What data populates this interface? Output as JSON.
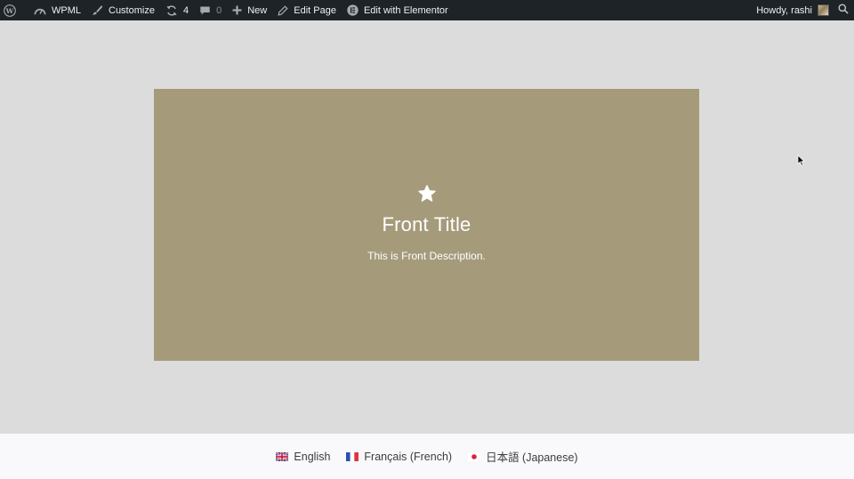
{
  "adminbar": {
    "site_name": "WPML",
    "customize": "Customize",
    "updates_count": "4",
    "comments_count": "0",
    "new_label": "New",
    "edit_page": "Edit Page",
    "edit_elementor": "Edit with Elementor",
    "howdy": "Howdy, rashi"
  },
  "hero": {
    "icon": "star-icon",
    "title": "Front Title",
    "description": "This is Front Description.",
    "background": "#a59b7b"
  },
  "languages": [
    {
      "label": "English",
      "flag": "uk-flag-icon"
    },
    {
      "label": "Français (French)",
      "flag": "france-flag-icon"
    },
    {
      "label": "日本語 (Japanese)",
      "flag": "japan-flag-icon"
    }
  ]
}
